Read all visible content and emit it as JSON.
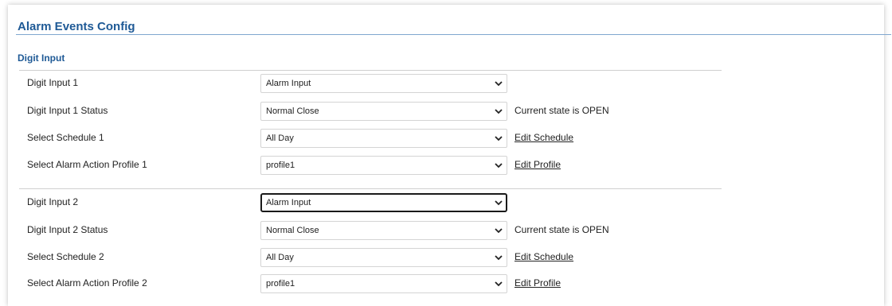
{
  "page": {
    "title": "Alarm Events Config"
  },
  "section": {
    "title": "Digit Input"
  },
  "groups": [
    {
      "input": {
        "label": "Digit Input 1",
        "value": "Alarm Input"
      },
      "status": {
        "label": "Digit Input 1 Status",
        "value": "Normal Close",
        "state_text": "Current state is OPEN"
      },
      "schedule": {
        "label": "Select Schedule 1",
        "value": "All Day",
        "link": "Edit Schedule"
      },
      "profile": {
        "label": "Select Alarm Action Profile 1",
        "value": "profile1",
        "link": "Edit Profile"
      }
    },
    {
      "input": {
        "label": "Digit Input 2",
        "value": "Alarm Input"
      },
      "status": {
        "label": "Digit Input 2 Status",
        "value": "Normal Close",
        "state_text": "Current state is OPEN"
      },
      "schedule": {
        "label": "Select Schedule 2",
        "value": "All Day",
        "link": "Edit Schedule"
      },
      "profile": {
        "label": "Select Alarm Action Profile 2",
        "value": "profile1",
        "link": "Edit Profile"
      }
    }
  ],
  "icons": {
    "dropdown": "chevron-down-icon"
  },
  "colors": {
    "heading": "#1f5a96",
    "rule": "#7fa6cf"
  }
}
